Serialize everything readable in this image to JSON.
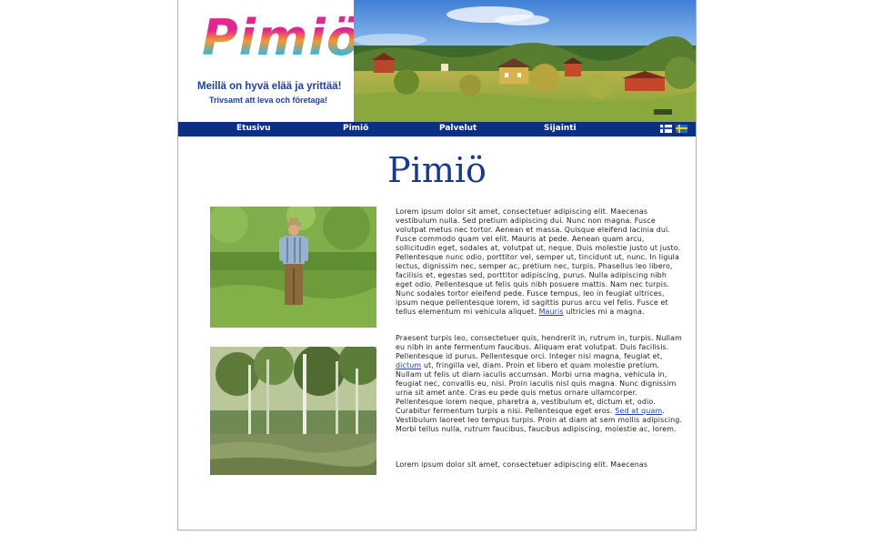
{
  "header": {
    "logo_text": "Pimiö",
    "slogan_fi": "Meillä on hyvä elää ja yrittää!",
    "slogan_sv": "Trivsamt att leva och företaga!"
  },
  "nav": {
    "items": [
      {
        "label": "Etusivu"
      },
      {
        "label": "Pimiö"
      },
      {
        "label": "Palvelut"
      },
      {
        "label": "Sijainti"
      }
    ],
    "flags": [
      "finnish-flag-icon",
      "swedish-flag-icon"
    ]
  },
  "main": {
    "title": "Pimiö",
    "para1_a": "Lorem ipsum dolor sit amet, consectetuer adipiscing elit. Maecenas vestibulum nulla. Sed pretium adipiscing dui. Nunc non magna. Fusce volutpat metus nec tortor. Aenean et massa. Quisque eleifend lacinia dui. Fusce commodo quam vel elit. Mauris at pede. Aenean quam arcu, sollicitudin eget, sodales at, volutpat ut, neque. Duis molestie justo ut justo. Pellentesque nunc odio, porttitor vel, semper ut, tincidunt ut, nunc. In ligula lectus, dignissim nec, semper ac, pretium nec, turpis. Phasellus leo libero, facilisis et, egestas sed, porttitor adipiscing, purus. Nulla adipiscing nibh eget odio. Pellentesque ut felis quis nibh posuere mattis. Nam nec turpis. Nunc sodales tortor eleifend pede. Fusce tempus, leo in feugiat ultrices, ipsum neque pellentesque lorem, id sagittis purus arcu vel felis. Fusce et tellus elementum mi vehicula aliquet. ",
    "para1_link": "Mauris",
    "para1_b": " ultricies mi a magna.",
    "para2_a": "Praesent turpis leo, consectetuer quis, hendrerit in, rutrum in, turpis. Nullam eu nibh in ante fermentum faucibus. Aliquam erat volutpat. Duis facilisis. Pellentesque id purus. Pellentesque orci. Integer nisi magna, feugiat et, ",
    "para2_link1": "dictum",
    "para2_b": " ut, fringilla vel, diam. Proin et libero et quam molestie pretium. Nullam ut felis ut diam iaculis accumsan. Morbi urna magna, vehicula in, feugiat nec, convallis eu, nisi. Proin iaculis nisl quis magna. Nunc dignissim urna sit amet ante. Cras eu pede quis metus ornare ullamcorper. Pellentesque lorem neque, pharetra a, vestibulum et, dictum et, odio. Curabitur fermentum turpis a nisi. Pellentesque eget eros. ",
    "para2_link2": "Sed at quam",
    "para2_c": ". Vestibulum laoreet leo tempus turpis. Proin at diam at sem mollis adipiscing. Morbi tellus nulla, rutrum faucibus, faucibus adipiscing, molestie ac, lorem.",
    "para3": "Lorem ipsum dolor sit amet, consectetuer adipiscing elit. Maecenas"
  }
}
